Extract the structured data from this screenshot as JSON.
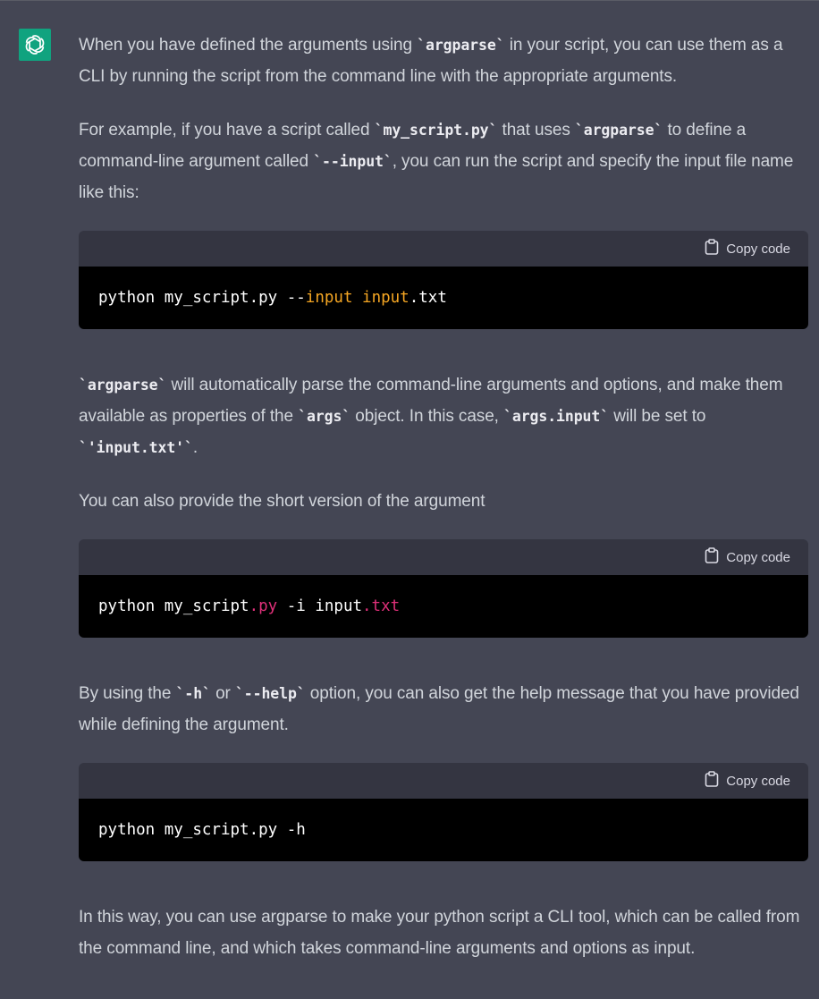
{
  "message": {
    "p1": {
      "t1": "When you have defined the arguments using ",
      "c1": "`argparse`",
      "t2": " in your script, you can use them as a CLI by running the script from the command line with the appropriate arguments."
    },
    "p2": {
      "t1": "For example, if you have a script called ",
      "c1": "`my_script.py`",
      "t2": " that uses ",
      "c2": "`argparse`",
      "t3": " to define a command-line argument called ",
      "c3": "`--input`",
      "t4": ", you can run the script and specify the input file name like this:"
    },
    "p3": {
      "c1": "`argparse`",
      "t1": " will automatically parse the command-line arguments and options, and make them available as properties of the ",
      "c2": "`args`",
      "t2": " object. In this case, ",
      "c3": "`args.input`",
      "t3": " will be set to ",
      "c4": "`'input.txt'`",
      "t4": "."
    },
    "p4": "You can also provide the short version of the argument",
    "p5": {
      "t1": "By using the ",
      "c1": "`-h`",
      "t2": " or ",
      "c2": "`--help`",
      "t3": " option, you can also get the help message that you have provided while defining the argument."
    },
    "p6": "In this way, you can use argparse to make your python script a CLI tool, which can be called from the command line, and which takes command-line arguments and options as input."
  },
  "copy_label": "Copy code",
  "code_blocks": [
    {
      "parts": [
        "python my_script.py --",
        "input",
        " ",
        "input",
        ".txt"
      ]
    },
    {
      "parts": [
        "python my_script",
        ".py",
        " -i input",
        ".txt"
      ]
    },
    {
      "parts": [
        "python my_script.py -h"
      ]
    }
  ],
  "colors": {
    "background": "#444654",
    "avatar": "#10a37f",
    "code_keyword": "#f5a623",
    "code_attr": "#df3079"
  },
  "icons": {
    "avatar": "openai-logo-icon",
    "copy": "clipboard-icon"
  }
}
